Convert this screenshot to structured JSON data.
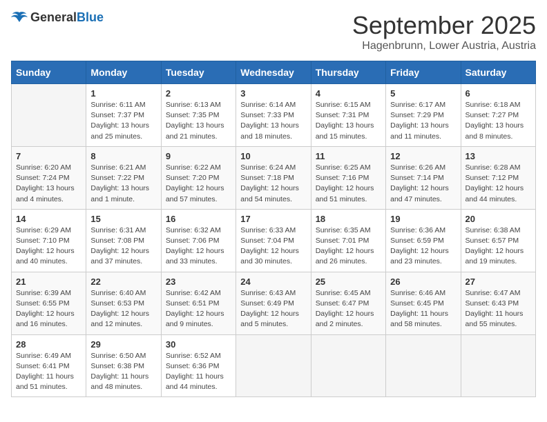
{
  "logo": {
    "general": "General",
    "blue": "Blue"
  },
  "title": "September 2025",
  "location": "Hagenbrunn, Lower Austria, Austria",
  "weekdays": [
    "Sunday",
    "Monday",
    "Tuesday",
    "Wednesday",
    "Thursday",
    "Friday",
    "Saturday"
  ],
  "weeks": [
    [
      {
        "day": null
      },
      {
        "day": 1,
        "sunrise": "6:11 AM",
        "sunset": "7:37 PM",
        "daylight": "13 hours and 25 minutes."
      },
      {
        "day": 2,
        "sunrise": "6:13 AM",
        "sunset": "7:35 PM",
        "daylight": "13 hours and 21 minutes."
      },
      {
        "day": 3,
        "sunrise": "6:14 AM",
        "sunset": "7:33 PM",
        "daylight": "13 hours and 18 minutes."
      },
      {
        "day": 4,
        "sunrise": "6:15 AM",
        "sunset": "7:31 PM",
        "daylight": "13 hours and 15 minutes."
      },
      {
        "day": 5,
        "sunrise": "6:17 AM",
        "sunset": "7:29 PM",
        "daylight": "13 hours and 11 minutes."
      },
      {
        "day": 6,
        "sunrise": "6:18 AM",
        "sunset": "7:27 PM",
        "daylight": "13 hours and 8 minutes."
      }
    ],
    [
      {
        "day": 7,
        "sunrise": "6:20 AM",
        "sunset": "7:24 PM",
        "daylight": "13 hours and 4 minutes."
      },
      {
        "day": 8,
        "sunrise": "6:21 AM",
        "sunset": "7:22 PM",
        "daylight": "13 hours and 1 minute."
      },
      {
        "day": 9,
        "sunrise": "6:22 AM",
        "sunset": "7:20 PM",
        "daylight": "12 hours and 57 minutes."
      },
      {
        "day": 10,
        "sunrise": "6:24 AM",
        "sunset": "7:18 PM",
        "daylight": "12 hours and 54 minutes."
      },
      {
        "day": 11,
        "sunrise": "6:25 AM",
        "sunset": "7:16 PM",
        "daylight": "12 hours and 51 minutes."
      },
      {
        "day": 12,
        "sunrise": "6:26 AM",
        "sunset": "7:14 PM",
        "daylight": "12 hours and 47 minutes."
      },
      {
        "day": 13,
        "sunrise": "6:28 AM",
        "sunset": "7:12 PM",
        "daylight": "12 hours and 44 minutes."
      }
    ],
    [
      {
        "day": 14,
        "sunrise": "6:29 AM",
        "sunset": "7:10 PM",
        "daylight": "12 hours and 40 minutes."
      },
      {
        "day": 15,
        "sunrise": "6:31 AM",
        "sunset": "7:08 PM",
        "daylight": "12 hours and 37 minutes."
      },
      {
        "day": 16,
        "sunrise": "6:32 AM",
        "sunset": "7:06 PM",
        "daylight": "12 hours and 33 minutes."
      },
      {
        "day": 17,
        "sunrise": "6:33 AM",
        "sunset": "7:04 PM",
        "daylight": "12 hours and 30 minutes."
      },
      {
        "day": 18,
        "sunrise": "6:35 AM",
        "sunset": "7:01 PM",
        "daylight": "12 hours and 26 minutes."
      },
      {
        "day": 19,
        "sunrise": "6:36 AM",
        "sunset": "6:59 PM",
        "daylight": "12 hours and 23 minutes."
      },
      {
        "day": 20,
        "sunrise": "6:38 AM",
        "sunset": "6:57 PM",
        "daylight": "12 hours and 19 minutes."
      }
    ],
    [
      {
        "day": 21,
        "sunrise": "6:39 AM",
        "sunset": "6:55 PM",
        "daylight": "12 hours and 16 minutes."
      },
      {
        "day": 22,
        "sunrise": "6:40 AM",
        "sunset": "6:53 PM",
        "daylight": "12 hours and 12 minutes."
      },
      {
        "day": 23,
        "sunrise": "6:42 AM",
        "sunset": "6:51 PM",
        "daylight": "12 hours and 9 minutes."
      },
      {
        "day": 24,
        "sunrise": "6:43 AM",
        "sunset": "6:49 PM",
        "daylight": "12 hours and 5 minutes."
      },
      {
        "day": 25,
        "sunrise": "6:45 AM",
        "sunset": "6:47 PM",
        "daylight": "12 hours and 2 minutes."
      },
      {
        "day": 26,
        "sunrise": "6:46 AM",
        "sunset": "6:45 PM",
        "daylight": "11 hours and 58 minutes."
      },
      {
        "day": 27,
        "sunrise": "6:47 AM",
        "sunset": "6:43 PM",
        "daylight": "11 hours and 55 minutes."
      }
    ],
    [
      {
        "day": 28,
        "sunrise": "6:49 AM",
        "sunset": "6:41 PM",
        "daylight": "11 hours and 51 minutes."
      },
      {
        "day": 29,
        "sunrise": "6:50 AM",
        "sunset": "6:38 PM",
        "daylight": "11 hours and 48 minutes."
      },
      {
        "day": 30,
        "sunrise": "6:52 AM",
        "sunset": "6:36 PM",
        "daylight": "11 hours and 44 minutes."
      },
      {
        "day": null
      },
      {
        "day": null
      },
      {
        "day": null
      },
      {
        "day": null
      }
    ]
  ]
}
